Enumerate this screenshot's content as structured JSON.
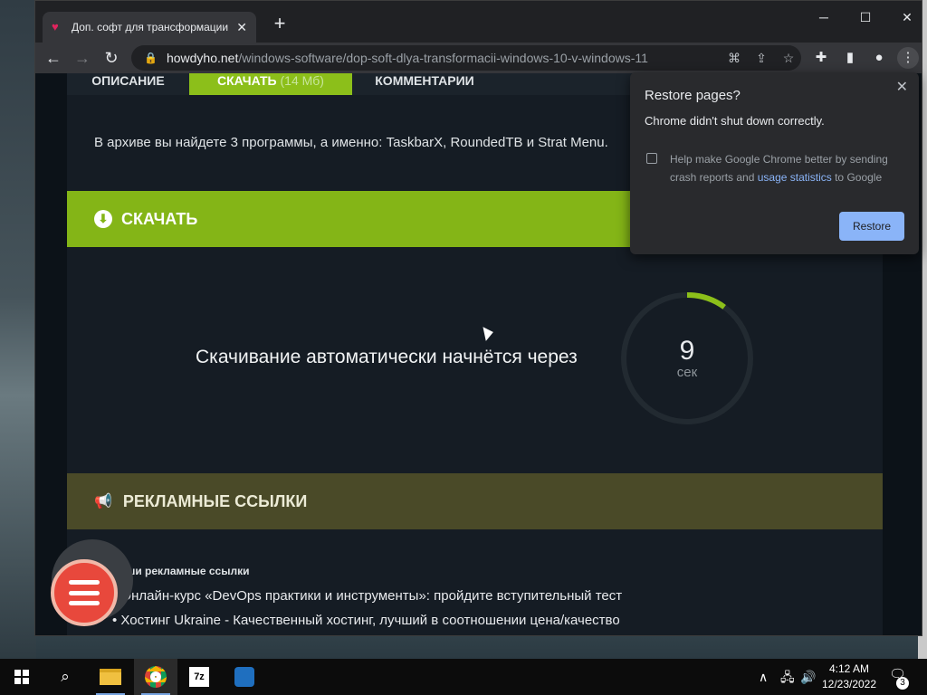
{
  "browser": {
    "tab_title": "Доп. софт для трансформации W",
    "url_host": "howdyho.net",
    "url_path": "/windows-software/dop-soft-dlya-transformacii-windows-10-v-windows-11",
    "window_controls": {
      "minimize": "─",
      "maximize": "☐",
      "close": "✕"
    }
  },
  "page": {
    "tabs": [
      {
        "label": "ОПИСАНИЕ"
      },
      {
        "label": "СКАЧАТЬ",
        "extra": "(14 Мб)"
      },
      {
        "label": "КОММЕНТАРИИ"
      }
    ],
    "archive_text": "В архиве вы найдете 3 программы, а именно: TaskbarX, RoundedTB и Strat Menu.",
    "download_label": "СКАЧАТЬ",
    "countdown_text": "Скачивание автоматически начнётся через",
    "countdown_value": "9",
    "countdown_unit": "сек",
    "countdown_progress": 0.1,
    "ads_label": "РЕКЛАМНЫЕ ССЫЛКИ",
    "ads_subtitle": "Наши рекламные ссылки",
    "ad_links": [
      "• Онлайн-курс «DevOps практики и инструменты»: пройдите вступительный тест",
      "• Хостинг Ukraine - Качественный хостинг, лучший в соотношении цена/качество"
    ]
  },
  "popup": {
    "title": "Restore pages?",
    "message": "Chrome didn't shut down correctly.",
    "help_prefix": "Help make Google Chrome better by sending crash reports and ",
    "help_link": "usage statistics",
    "help_suffix": " to Google",
    "restore_label": "Restore"
  },
  "taskbar": {
    "time": "4:12 AM",
    "date": "12/23/2022",
    "notification_count": "3",
    "apps": [
      "file-explorer",
      "chrome",
      "7zip",
      "app-blue"
    ]
  },
  "colors": {
    "accent_green": "#84b517",
    "ads_olive": "#4a4a28",
    "restore_blue": "#8ab4f8"
  }
}
